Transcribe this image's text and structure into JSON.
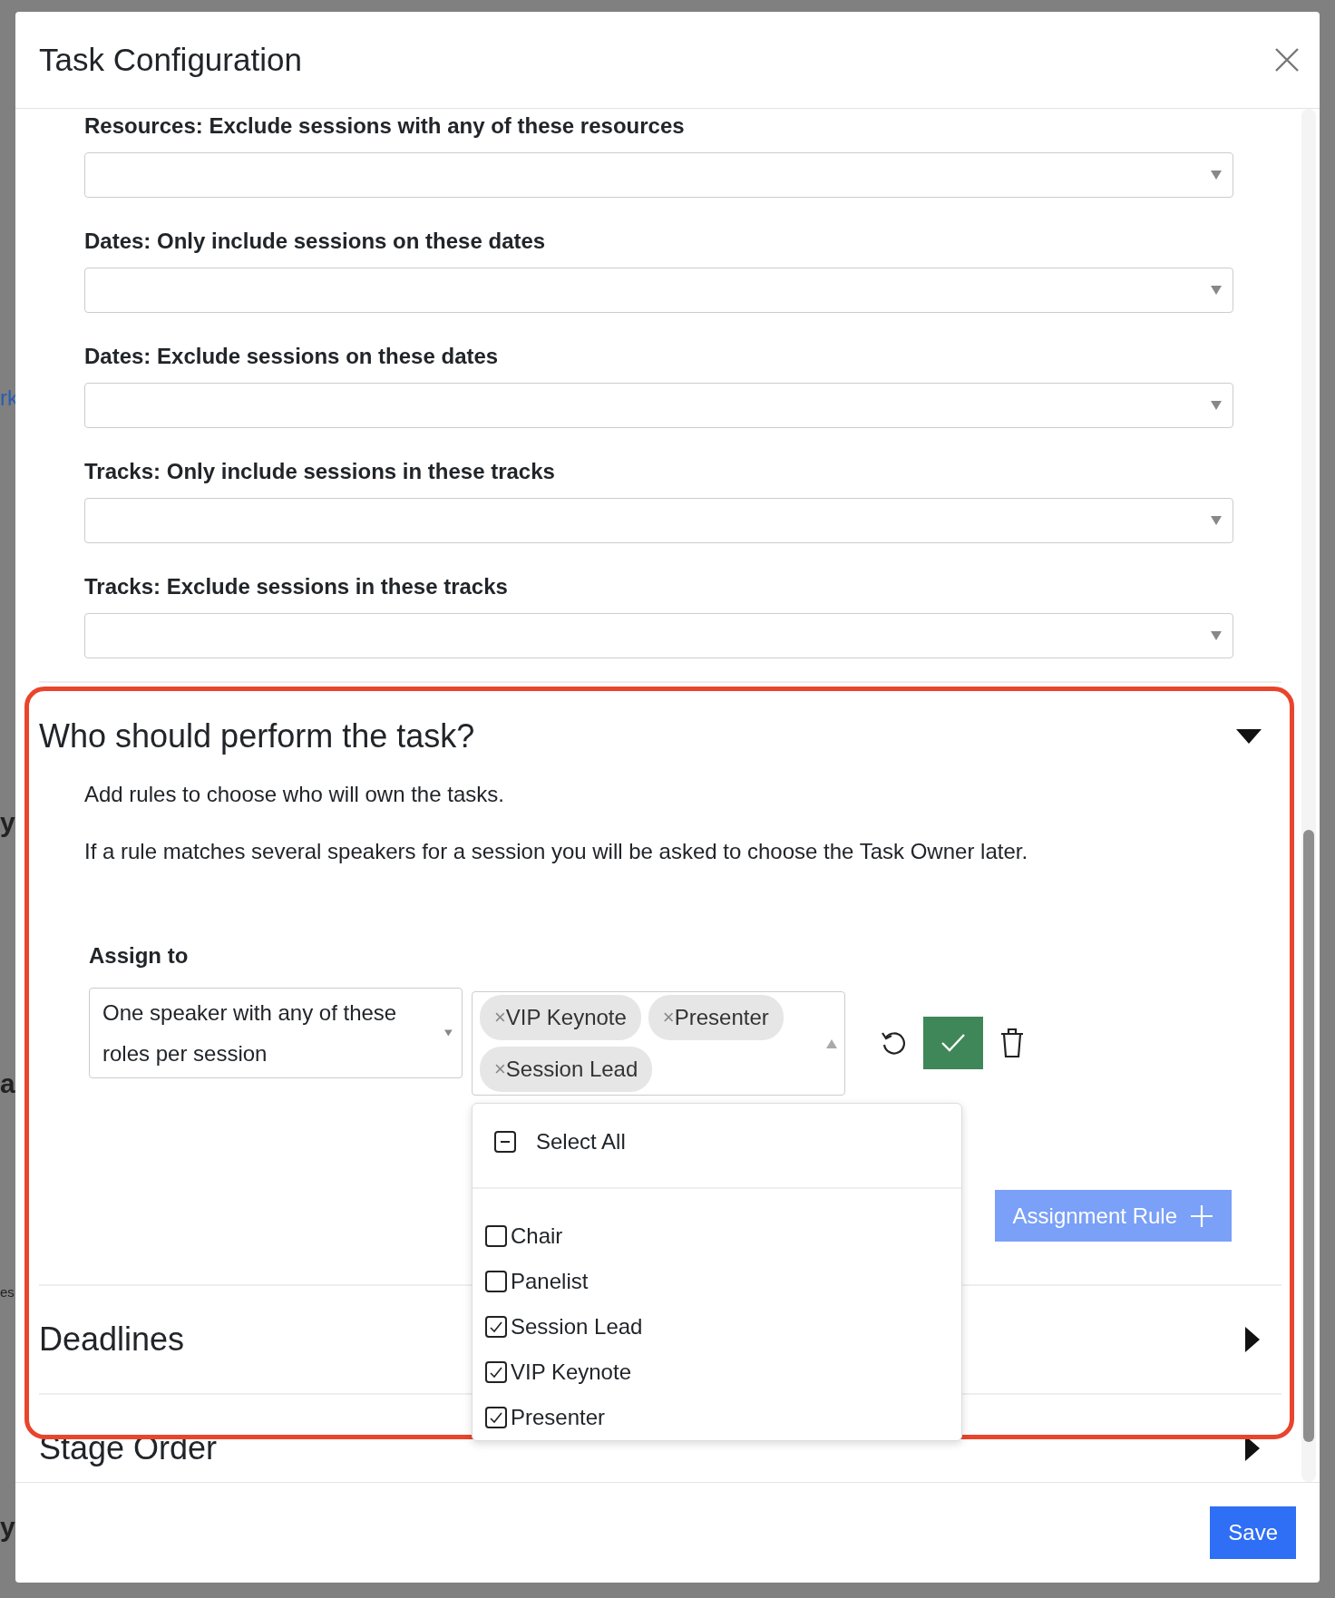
{
  "backdrop": {
    "texts": [
      {
        "text": "rk",
        "kind": "link"
      },
      {
        "text": "y",
        "kind": "bold"
      },
      {
        "text": "a",
        "kind": "bold"
      },
      {
        "text": "es",
        "kind": "plain"
      },
      {
        "text": "y",
        "kind": "bold"
      }
    ]
  },
  "dialog": {
    "title": "Task Configuration",
    "filters": [
      {
        "label": "Resources: Exclude sessions with any of these resources"
      },
      {
        "label": "Dates: Only include sessions on these dates"
      },
      {
        "label": "Dates: Exclude sessions on these dates"
      },
      {
        "label": "Tracks: Only include sessions in these tracks"
      },
      {
        "label": "Tracks: Exclude sessions in these tracks"
      }
    ],
    "sections": [
      {
        "title": "Who should perform the task?",
        "expanded": true,
        "intro": [
          "Add rules to choose who will own the tasks.",
          "If a rule matches several speakers for a session you will be asked to choose the Task Owner later."
        ],
        "assign_label": "Assign to",
        "mode_select": {
          "value": "One speaker with any of these roles per session"
        },
        "roles_select": {
          "open": true,
          "remove_symbol": "×",
          "tags": [
            "VIP Keynote",
            "Presenter",
            "Session Lead"
          ],
          "select_all": {
            "label": "Select All",
            "checked": false,
            "indeterminate": true
          },
          "options": [
            {
              "label": "Chair",
              "checked": false
            },
            {
              "label": "Panelist",
              "checked": false
            },
            {
              "label": "Session Lead",
              "checked": true
            },
            {
              "label": "VIP Keynote",
              "checked": true
            },
            {
              "label": "Presenter",
              "checked": true
            }
          ]
        },
        "add_rule_button": {
          "label": "Assignment Rule",
          "disabled": true
        }
      },
      {
        "title": "Deadlines",
        "expanded": false
      },
      {
        "title": "Stage Order",
        "expanded": false
      }
    ],
    "save_button": {
      "label": "Save"
    }
  },
  "annotation": {
    "kind": "frame"
  }
}
